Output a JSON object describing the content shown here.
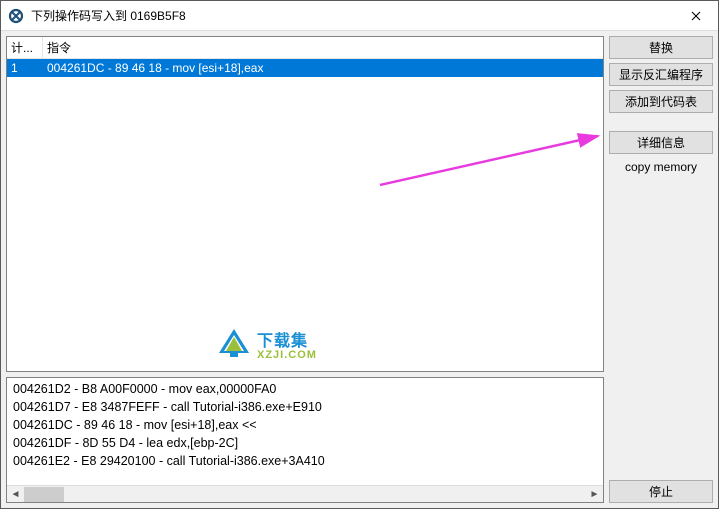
{
  "title": "下列操作码写入到 0169B5F8",
  "columns": {
    "count": "计...",
    "instruction": "指令"
  },
  "list": {
    "rows": [
      {
        "count": "1",
        "instruction": "004261DC - 89 46 18  - mov [esi+18],eax"
      }
    ]
  },
  "detail": {
    "lines": [
      "004261D2 - B8 A00F0000 - mov eax,00000FA0",
      "004261D7 - E8 3487FEFF - call Tutorial-i386.exe+E910",
      "004261DC - 89 46 18  - mov [esi+18],eax <<",
      "004261DF - 8D 55 D4  - lea edx,[ebp-2C]",
      "004261E2 - E8 29420100 - call Tutorial-i386.exe+3A410"
    ]
  },
  "buttons": {
    "replace": "替换",
    "disasm": "显示反汇编程序",
    "addtable": "添加到代码表",
    "details": "详细信息",
    "copymem": "copy memory",
    "stop": "停止"
  },
  "watermark": {
    "title": "下载集",
    "sub": "XZJI.COM"
  }
}
